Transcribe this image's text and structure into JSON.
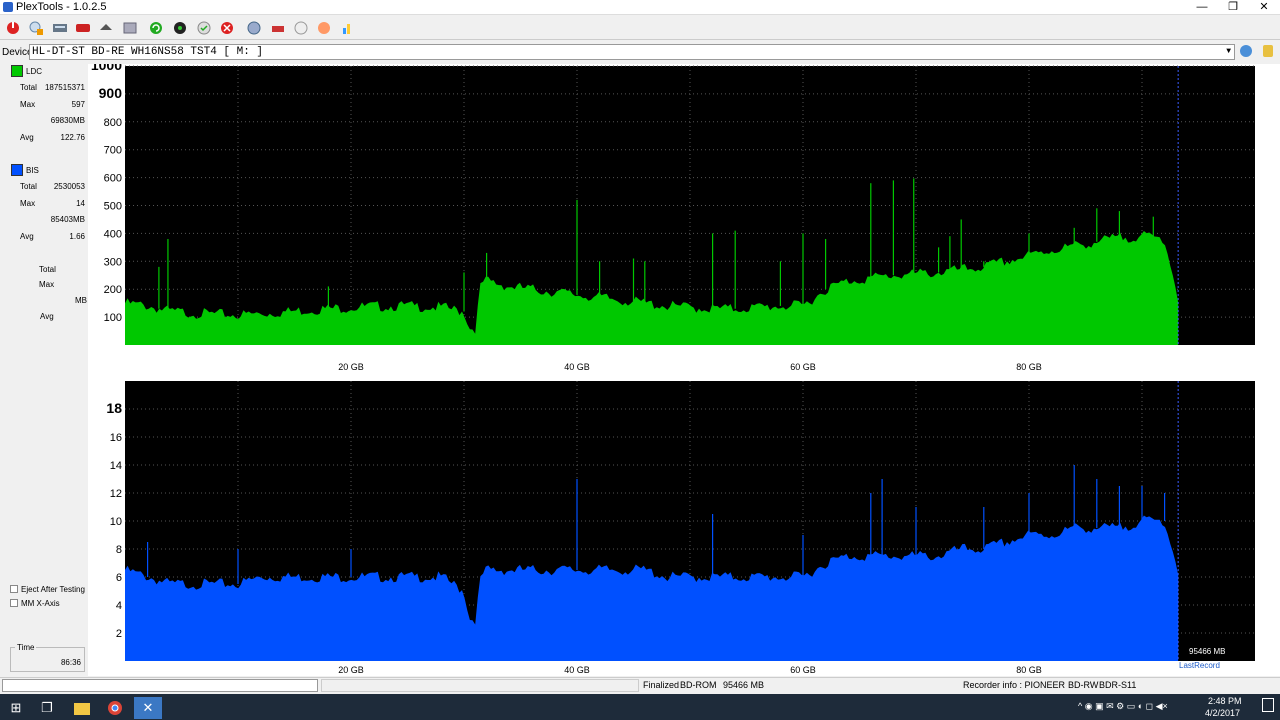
{
  "app": {
    "title": "PlexTools - 1.0.2.5"
  },
  "window_controls": {
    "minimize": "—",
    "restore": "❐",
    "close": "✕"
  },
  "device": {
    "label": "Device:",
    "value": "HL-DT-ST BD-RE  WH16NS58  TST4 [ M: ]"
  },
  "ldc": {
    "legend": "LDC",
    "color": "#00c800",
    "total_label": "Total",
    "total": "187515371",
    "max_label": "Max",
    "max": "597",
    "max_pos": "69830MB",
    "avg_label": "Avg",
    "avg": "122.76"
  },
  "bis": {
    "legend": "BIS",
    "color": "#0050ff",
    "total_label": "Total",
    "total": "2530053",
    "max_label": "Max",
    "max": "14",
    "max_pos": "85403MB",
    "avg_label": "Avg",
    "avg": "1.66"
  },
  "third": {
    "total_label": "Total",
    "max_label": "Max",
    "mb_label": "MB",
    "avg_label": "Avg"
  },
  "options": {
    "eject": "Eject After Testing",
    "mmx": "MM X-Axis"
  },
  "time": {
    "label": "Time",
    "value": "86:36"
  },
  "chart_data": [
    {
      "type": "area",
      "series": [
        {
          "name": "LDC"
        }
      ],
      "ylim": [
        0,
        1000
      ],
      "yticks": [
        "100",
        "200",
        "300",
        "400",
        "500",
        "600",
        "700",
        "800",
        "900",
        "1000"
      ],
      "xticks": [
        "20 GB",
        "40 GB",
        "60 GB",
        "80 GB"
      ],
      "xlim": [
        0,
        100
      ],
      "end_gb": 93.2,
      "profile_gb": [
        0,
        2,
        4,
        6,
        8,
        10,
        12,
        14,
        16,
        18,
        20,
        22,
        24,
        26,
        28,
        30,
        30.5,
        31,
        31.5,
        32,
        34,
        36,
        38,
        40,
        42,
        44,
        46,
        48,
        50,
        52,
        54,
        56,
        58,
        60,
        62,
        64,
        66,
        68,
        70,
        72,
        74,
        76,
        78,
        80,
        82,
        84,
        86,
        88,
        90,
        92,
        93.2
      ],
      "profile_val": [
        150,
        140,
        120,
        115,
        110,
        108,
        112,
        118,
        125,
        130,
        135,
        138,
        140,
        138,
        135,
        120,
        60,
        60,
        220,
        230,
        210,
        200,
        190,
        180,
        170,
        160,
        150,
        140,
        135,
        130,
        130,
        135,
        140,
        140,
        200,
        230,
        240,
        250,
        255,
        260,
        270,
        280,
        300,
        320,
        340,
        355,
        370,
        385,
        390,
        380,
        170
      ],
      "spikes": [
        [
          3,
          280
        ],
        [
          3.8,
          380
        ],
        [
          18,
          210
        ],
        [
          30,
          260
        ],
        [
          32,
          330
        ],
        [
          40,
          520
        ],
        [
          42,
          300
        ],
        [
          45,
          310
        ],
        [
          46,
          300
        ],
        [
          52,
          400
        ],
        [
          54,
          410
        ],
        [
          58,
          300
        ],
        [
          60,
          400
        ],
        [
          62,
          380
        ],
        [
          66,
          580
        ],
        [
          68,
          590
        ],
        [
          69.8,
          597
        ],
        [
          72,
          350
        ],
        [
          73,
          390
        ],
        [
          74,
          450
        ],
        [
          76,
          300
        ],
        [
          80,
          400
        ],
        [
          84,
          420
        ],
        [
          86,
          490
        ],
        [
          88,
          480
        ],
        [
          91,
          460
        ]
      ]
    },
    {
      "type": "area",
      "series": [
        {
          "name": "BIS"
        }
      ],
      "ylim": [
        0,
        20
      ],
      "yticks": [
        "2",
        "4",
        "6",
        "8",
        "10",
        "12",
        "14",
        "16",
        "18"
      ],
      "xticks": [
        "20 GB",
        "40 GB",
        "60 GB",
        "80 GB"
      ],
      "xlim": [
        0,
        100
      ],
      "end_gb": 93.2,
      "profile_gb": [
        0,
        2,
        4,
        6,
        8,
        10,
        12,
        14,
        16,
        18,
        20,
        22,
        24,
        26,
        28,
        30,
        30.5,
        31,
        31.5,
        32,
        34,
        36,
        38,
        40,
        42,
        44,
        46,
        48,
        50,
        52,
        54,
        56,
        58,
        60,
        62,
        64,
        66,
        68,
        70,
        72,
        74,
        76,
        78,
        80,
        82,
        84,
        86,
        88,
        90,
        92,
        93.2
      ],
      "profile_val": [
        6.5,
        6,
        5.5,
        5.5,
        5.5,
        5.5,
        6,
        6,
        6,
        6,
        6,
        6,
        6,
        6,
        6,
        5,
        3,
        3,
        6,
        6.5,
        6.5,
        6.5,
        6.5,
        6.5,
        6.5,
        6.5,
        6.5,
        6,
        6,
        6,
        6,
        6,
        6,
        6,
        7,
        7.5,
        7.5,
        7.5,
        7.5,
        7.5,
        8,
        8,
        8.5,
        9,
        9,
        9.5,
        9.5,
        9.5,
        10,
        10,
        6.5
      ],
      "spikes": [
        [
          2,
          8.5
        ],
        [
          10,
          8
        ],
        [
          20,
          8
        ],
        [
          40,
          13
        ],
        [
          52,
          10.5
        ],
        [
          60,
          9
        ],
        [
          66,
          12
        ],
        [
          67,
          13
        ],
        [
          70,
          11
        ],
        [
          76,
          11
        ],
        [
          80,
          12
        ],
        [
          84,
          14
        ],
        [
          86,
          13
        ],
        [
          88,
          12.5
        ],
        [
          90,
          12.5
        ],
        [
          92,
          12
        ]
      ],
      "end_label": "95466 MB",
      "last_label": "LastRecord"
    }
  ],
  "status": {
    "finalized": "Finalized",
    "media": "BD-ROM",
    "size": "95466 MB",
    "recorder_label": "Recorder info : PIONEER",
    "recorder_type": "BD-RW",
    "recorder_model": "BDR-S11"
  },
  "taskbar": {
    "time": "2:48 PM",
    "date": "4/2/2017"
  }
}
